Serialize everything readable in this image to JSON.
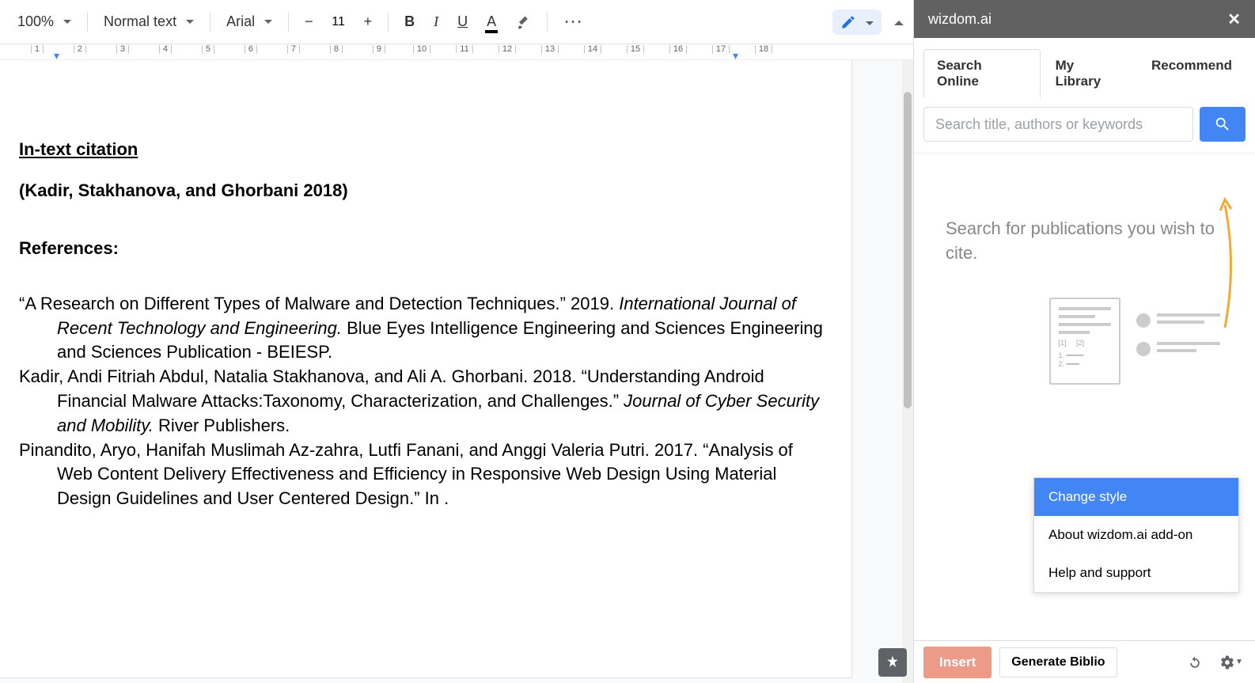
{
  "toolbar": {
    "zoom": "100%",
    "style": "Normal text",
    "font": "Arial",
    "fontSize": "11",
    "bold": "B",
    "italic": "I",
    "underline": "U",
    "textColor": "A"
  },
  "ruler": {
    "marks": [
      "1",
      "2",
      "3",
      "4",
      "5",
      "6",
      "7",
      "8",
      "9",
      "10",
      "11",
      "12",
      "13",
      "14",
      "15",
      "16",
      "17",
      "18"
    ]
  },
  "document": {
    "heading1": "In-text citation",
    "citation": "(Kadir, Stakhanova, and Ghorbani 2018)",
    "heading2": "References:",
    "ref1_a": "“A Research on Different Types of Malware and Detection Techniques.” 2019. ",
    "ref1_b": "International Journal of Recent Technology and Engineering.",
    "ref1_c": " Blue Eyes Intelligence Engineering and Sciences Engineering and Sciences Publication - BEIESP.",
    "ref2_a": "Kadir, Andi Fitriah Abdul, Natalia Stakhanova, and Ali A. Ghorbani. 2018. “Understanding Android Financial Malware Attacks:Taxonomy, Characterization, and Challenges.” ",
    "ref2_b": "Journal of Cyber Security and Mobility.",
    "ref2_c": " River Publishers.",
    "ref3": "Pinandito, Aryo, Hanifah Muslimah Az-zahra, Lutfi Fanani, and Anggi Valeria Putri. 2017. “Analysis of Web Content Delivery Effectiveness and Efficiency in Responsive Web Design Using Material Design Guidelines and User Centered Design.” In ."
  },
  "sidebar": {
    "title": "wizdom.ai",
    "tabs": {
      "search": "Search Online",
      "library": "My Library",
      "recommend": "Recommend"
    },
    "searchPlaceholder": "Search title, authors or keywords",
    "prompt": "Search for publications you wish to cite.",
    "popup": {
      "change": "Change style",
      "about": "About wizdom.ai add-on",
      "help": "Help and support"
    },
    "footer": {
      "insert": "Insert",
      "generate": "Generate Biblio"
    }
  }
}
